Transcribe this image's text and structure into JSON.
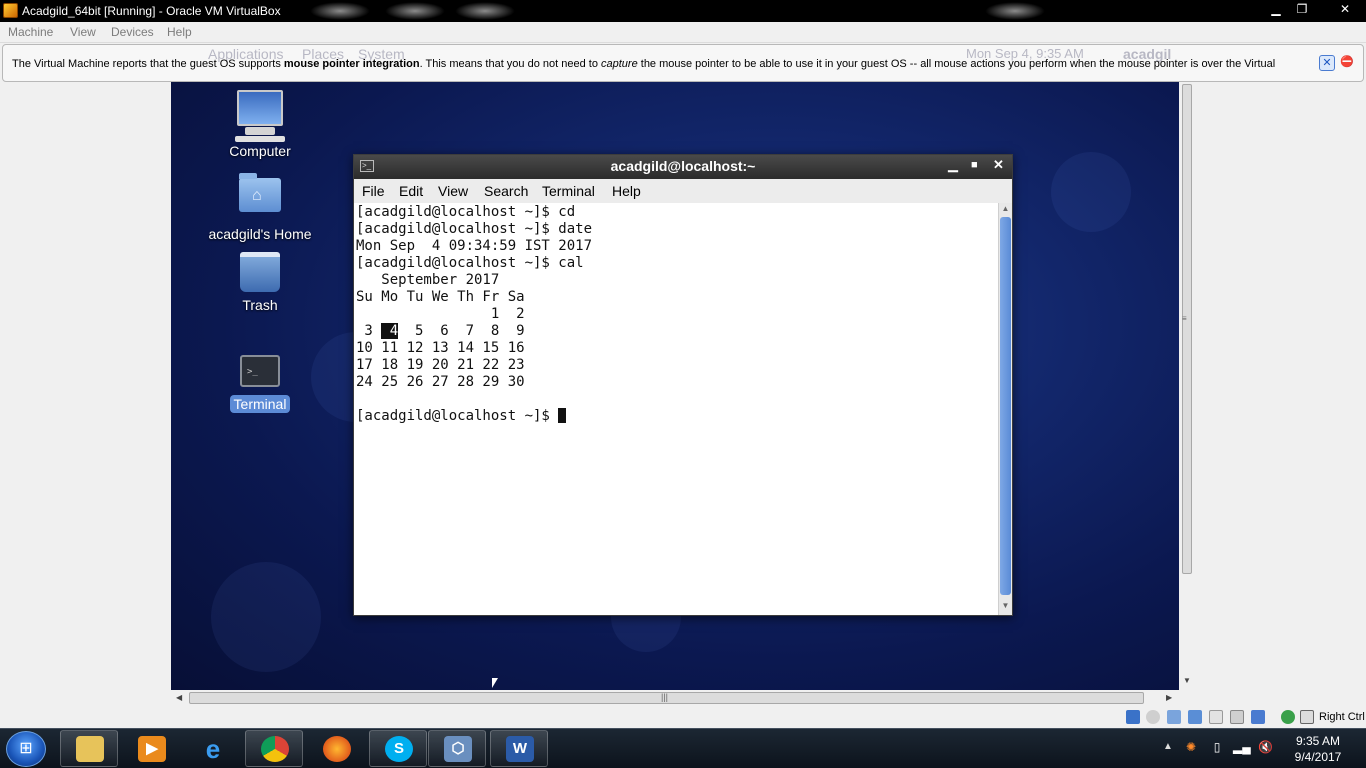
{
  "window": {
    "title": "Acadgild_64bit [Running] - Oracle VM VirtualBox",
    "min": "▁",
    "max": "❐",
    "close": "✕"
  },
  "menu": [
    "Machine",
    "View",
    "Devices",
    "Help"
  ],
  "guest_panel": {
    "applications": "Applications",
    "places": "Places",
    "system": "System",
    "clock": "Mon Sep  4,  9:35 AM",
    "user": "acadgil"
  },
  "notice": {
    "part1": "The Virtual Machine reports that the guest OS supports ",
    "bold": "mouse pointer integration",
    "part2": ". This means that you do not need to ",
    "italic": "capture",
    "part3": " the mouse pointer to be able to use it in your guest OS -- all mouse actions you perform when the mouse pointer is over the Virtual"
  },
  "desktop": {
    "icons": [
      {
        "label": "Computer"
      },
      {
        "label": "acadgild's Home"
      },
      {
        "label": "Trash"
      },
      {
        "label": "Terminal"
      }
    ]
  },
  "terminal": {
    "title": "acadgild@localhost:~",
    "menu": [
      "File",
      "Edit",
      "View",
      "Search",
      "Terminal",
      "Help"
    ],
    "lines_before": "[acadgild@localhost ~]$ cd\n[acadgild@localhost ~]$ date\nMon Sep  4 09:34:59 IST 2017\n[acadgild@localhost ~]$ cal\n   September 2017\nSu Mo Tu We Th Fr Sa\n                1  2\n ",
    "today": " 4",
    "lines_after": "  5  6  7  8  9\n10 11 12 13 14 15 16\n17 18 19 20 21 22 23\n24 25 26 27 28 29 30\n\n[acadgild@localhost ~]$ ",
    "cal_first": " 3 "
  },
  "statusbar": {
    "host_key": "Right Ctrl"
  },
  "taskbar": {
    "time": "9:35 AM",
    "date": "9/4/2017"
  }
}
